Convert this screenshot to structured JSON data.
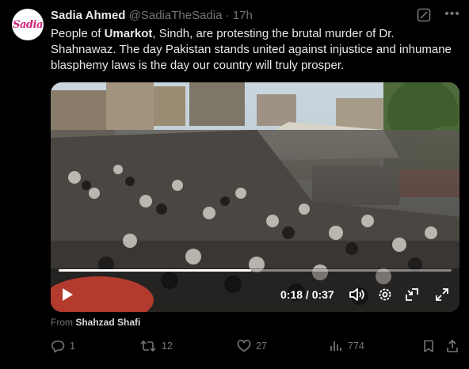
{
  "tweet": {
    "avatar_text": "Sadia",
    "author_name": "Sadia Ahmed",
    "handle": "@SadiaTheSadia",
    "separator": "·",
    "time": "17h",
    "text_prefix": "People of ",
    "text_bold": "Umarkot",
    "text_rest": ", Sindh, are protesting the brutal murder of Dr. Shahnawaz. The day Pakistan stands united against injustice and inhumane blasphemy laws is the day our country will truly prosper."
  },
  "video": {
    "time_display": "0:18 / 0:37",
    "progress_fraction": 0.49,
    "from_label": "From",
    "from_name": "Shahzad Shafi"
  },
  "actions": {
    "replies": "1",
    "reposts": "12",
    "likes": "27",
    "views": "774"
  },
  "colors": {
    "background": "#000000",
    "primary_text": "#e7e9ea",
    "secondary_text": "#71767b",
    "avatar_brand": "#d0217a"
  },
  "icons": [
    "grok-icon",
    "more-icon",
    "play-icon",
    "volume-icon",
    "settings-icon",
    "pip-icon",
    "fullscreen-icon",
    "reply-icon",
    "repost-icon",
    "like-icon",
    "views-icon",
    "bookmark-icon",
    "share-icon"
  ]
}
